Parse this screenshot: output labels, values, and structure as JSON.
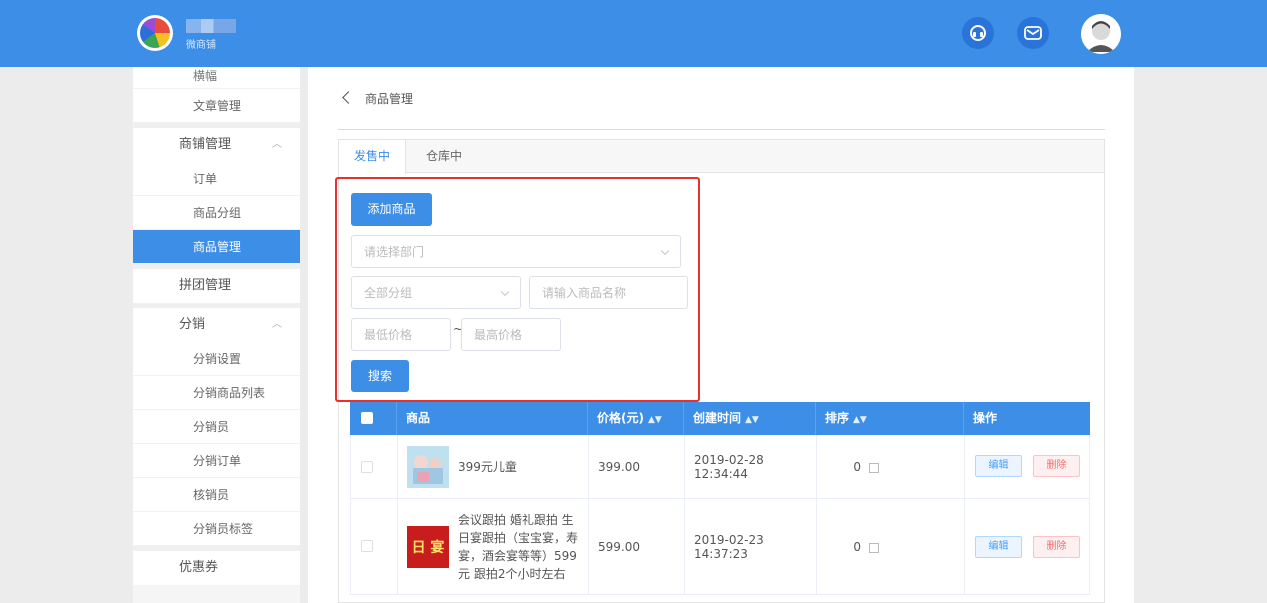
{
  "header": {
    "brand_text": "微商铺"
  },
  "sidebar": {
    "top_item": "横幅",
    "article": "文章管理",
    "shop_group": "商铺管理",
    "shop_items": [
      "订单",
      "商品分组",
      "商品管理"
    ],
    "group_buy": "拼团管理",
    "distribution_group": "分销",
    "distribution_items": [
      "分销设置",
      "分销商品列表",
      "分销员",
      "分销订单",
      "核销员",
      "分销员标签"
    ],
    "coupon": "优惠券"
  },
  "main": {
    "back_label": "商品管理",
    "tabs": [
      "发售中",
      "仓库中"
    ],
    "add_button": "添加商品",
    "department_placeholder": "请选择部门",
    "group_select": "全部分组",
    "name_placeholder": "请输入商品名称",
    "min_price_placeholder": "最低价格",
    "max_price_placeholder": "最高价格",
    "tilde": "~",
    "search_button": "搜索"
  },
  "table": {
    "headers": [
      "商品",
      "价格(元)",
      "创建时间",
      "排序",
      "操作"
    ],
    "rows": [
      {
        "name": "399元儿童",
        "price": "399.00",
        "created": "2019-02-28 12:34:44",
        "sort": "0",
        "edit": "编辑",
        "delete": "删除"
      },
      {
        "name": "会议跟拍 婚礼跟拍 生日宴跟拍（宝宝宴，寿宴，酒会宴等等）599元 跟拍2个小时左右",
        "price": "599.00",
        "created": "2019-02-23 14:37:23",
        "sort": "0",
        "edit": "编辑",
        "delete": "删除"
      }
    ],
    "thumb_text": "日 宴"
  },
  "colors": {
    "primary": "#3c8ee6",
    "highlight": "#e5322d"
  }
}
